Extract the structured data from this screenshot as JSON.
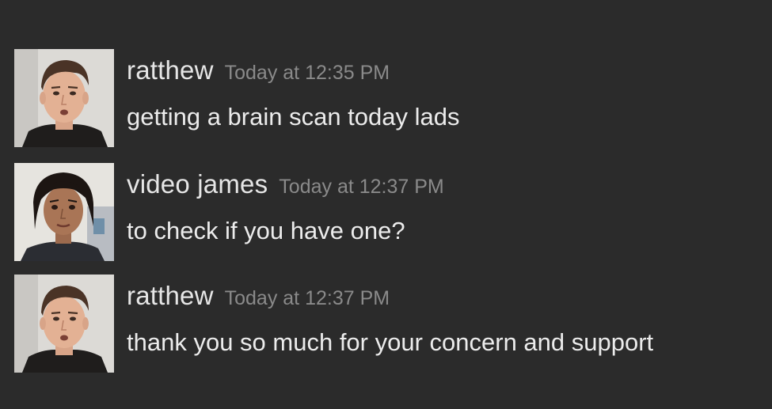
{
  "messages": [
    {
      "author": "ratthew",
      "timestamp": "Today at 12:35 PM",
      "content": "getting a brain scan today lads",
      "avatar_icon": "man-avatar"
    },
    {
      "author": "video james",
      "timestamp": "Today at 12:37 PM",
      "content": "to check if you have one?",
      "avatar_icon": "woman-avatar"
    },
    {
      "author": "ratthew",
      "timestamp": "Today at 12:37 PM",
      "content": "thank you so much for your concern and support",
      "avatar_icon": "man-avatar"
    }
  ],
  "colors": {
    "background": "#2b2b2b",
    "username": "#e6e6e6",
    "timestamp": "#8a8a8a",
    "content": "#ececec"
  }
}
